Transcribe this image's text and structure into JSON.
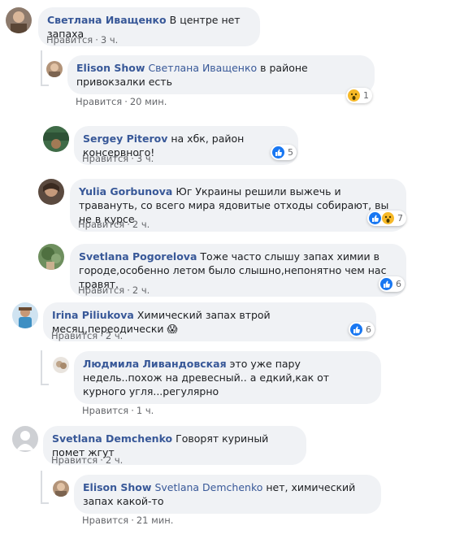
{
  "comments": [
    {
      "author": "Светлана Иващенко",
      "text": "В центре нет запаха",
      "like": "Нравится",
      "time": "3 ч."
    },
    {
      "author": "Elison Show",
      "tag": "Светлана Иващенко",
      "text": "в районе привокзалки есть",
      "like": "Нравится",
      "time": "20 мин.",
      "reactions": {
        "count": "1",
        "icons": [
          "wow-icon"
        ]
      }
    },
    {
      "author": "Sergey Piterov",
      "text": "на хбк, район консервного!",
      "like": "Нравится",
      "time": "3 ч.",
      "reactions": {
        "count": "5",
        "icons": [
          "like-icon"
        ]
      }
    },
    {
      "author": "Yulia Gorbunova",
      "text": "Юг Украины решили выжечь и травануть, со всего мира ядовитые отходы собирают, вы не в курсе",
      "like": "Нравится",
      "time": "2 ч.",
      "reactions": {
        "count": "7",
        "icons": [
          "like-icon",
          "wow-icon"
        ]
      }
    },
    {
      "author": "Svetlana Pogorelova",
      "text": "Тоже часто слышу запах химии в городе,особенно летом было слышно,непонятно чем нас травят.",
      "like": "Нравится",
      "time": "2 ч.",
      "reactions": {
        "count": "6",
        "icons": [
          "like-icon"
        ]
      }
    },
    {
      "author": "Irina Piliukova",
      "text": "Химический запах втрой месяц,переодически 😱",
      "like": "Нравится",
      "time": "2 ч.",
      "reactions": {
        "count": "6",
        "icons": [
          "like-icon"
        ]
      }
    },
    {
      "author": "Людмила Ливандовская",
      "text": "это уже пару недель..похож на древесный.. а едкий,как от курного угля...регулярно",
      "like": "Нравится",
      "time": "1 ч."
    },
    {
      "author": "Svetlana Demchenko",
      "text": "Говорят куриный помет жгут",
      "like": "Нравится",
      "time": "2 ч."
    },
    {
      "author": "Elison Show",
      "tag": "Svetlana Demchenko",
      "text": "нет, химический запах какой-то",
      "like": "Нравится",
      "time": "21 мин."
    }
  ],
  "separator": "·",
  "colors": {
    "link": "#385898",
    "bubble": "#f0f2f5",
    "meta": "#65676b",
    "like_blue": "#1877f2",
    "wow_yellow": "#f7b928"
  }
}
